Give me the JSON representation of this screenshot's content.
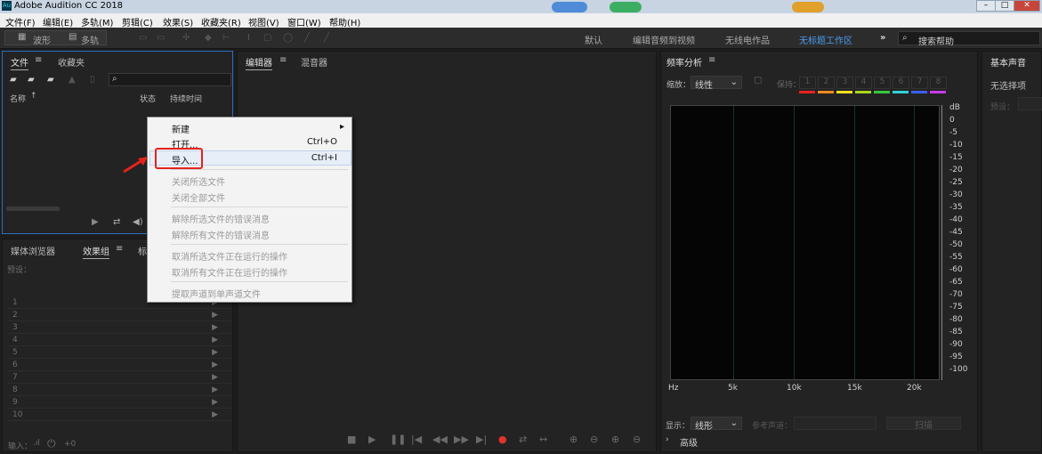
{
  "title": "Adobe Audition CC 2018",
  "menu": [
    "文件(F)",
    "编辑(E)",
    "多轨(M)",
    "剪辑(C)",
    "效果(S)",
    "收藏夹(R)",
    "视图(V)",
    "窗口(W)",
    "帮助(H)"
  ],
  "toolbar": {
    "wave": "波形",
    "multi": "多轨"
  },
  "workspaces": [
    "默认",
    "编辑音频到视频",
    "无线电作品",
    "无标题工作区"
  ],
  "search_placeholder": "搜索帮助",
  "files_panel": {
    "tab_files": "文件",
    "tab_fav": "收藏夹",
    "col_name": "名称",
    "col_status": "状态",
    "col_duration": "持续时间"
  },
  "context_menu": {
    "new": "新建",
    "open": "打开...",
    "open_sc": "Ctrl+O",
    "import": "导入...",
    "import_sc": "Ctrl+I",
    "close_sel": "关闭所选文件",
    "close_all": "关闭全部文件",
    "dismiss_sel": "解除所选文件的错误消息",
    "dismiss_all": "解除所有文件的错误消息",
    "cancel_sel": "取消所选文件正在运行的操作",
    "cancel_all": "取消所有文件正在运行的操作",
    "extract": "提取声道到单声道文件"
  },
  "effects_panel": {
    "tab_media": "媒体浏览器",
    "tab_fx": "效果组",
    "tab_mark": "标",
    "preset": "预设：",
    "rows": [
      "1",
      "2",
      "3",
      "4",
      "5",
      "6",
      "7",
      "8",
      "9",
      "10"
    ],
    "input": "输入：",
    "zero": "+0"
  },
  "editor": {
    "tab_editor": "编辑器",
    "tab_mixer": "混音器"
  },
  "freq": {
    "title": "频率分析",
    "scale_label": "缩放：",
    "scale_value": "线性",
    "hold": "保持：",
    "hold_nums": [
      "1",
      "2",
      "3",
      "4",
      "5",
      "6",
      "7",
      "8"
    ],
    "hold_colors": [
      "#e8221f",
      "#f08a1c",
      "#f0e21c",
      "#a9d61d",
      "#36c73c",
      "#2fd0d8",
      "#3a5ff0",
      "#c93ae8"
    ],
    "db_labels": [
      "dB",
      "0",
      "-5",
      "-10",
      "-15",
      "-20",
      "-25",
      "-30",
      "-35",
      "-40",
      "-45",
      "-50",
      "-55",
      "-60",
      "-65",
      "-70",
      "-75",
      "-80",
      "-85",
      "-90",
      "-95",
      "-100"
    ],
    "hz_labels": [
      "Hz",
      "5k",
      "10k",
      "15k",
      "20k"
    ],
    "display_label": "显示：",
    "display_value": "线形",
    "ref_channel": "参考声道：",
    "scan": "扫描",
    "advanced": "高级"
  },
  "basic_sound": {
    "title": "基本声音",
    "no_selection": "无选择项",
    "preset": "预设："
  }
}
